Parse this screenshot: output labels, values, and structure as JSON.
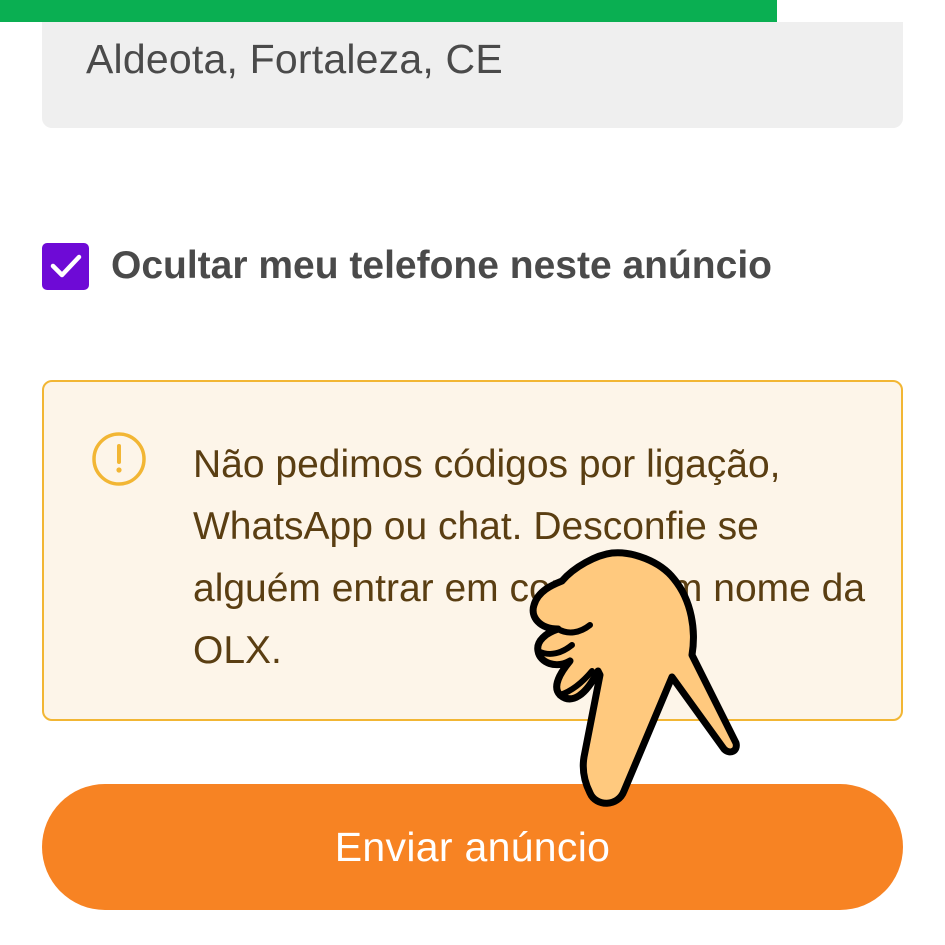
{
  "progress": {
    "percent": 86,
    "color": "#0aaf52"
  },
  "location": {
    "value": "Aldeota, Fortaleza, CE"
  },
  "hide_phone": {
    "checked": true,
    "label": "Ocultar meu telefone neste anúncio",
    "color": "#6e0ad6",
    "icon": "checkmark-icon"
  },
  "notice": {
    "icon": "exclamation-circle-icon",
    "text": "Não pedimos códigos por ligação, WhatsApp ou chat. Desconfie se alguém entrar em contato em nome da OLX.",
    "border_color": "#f2b634",
    "background": "#fdf5e9"
  },
  "submit": {
    "label": "Enviar anúncio",
    "color": "#f78323"
  },
  "overlay": {
    "icon": "pointing-hand-icon"
  }
}
